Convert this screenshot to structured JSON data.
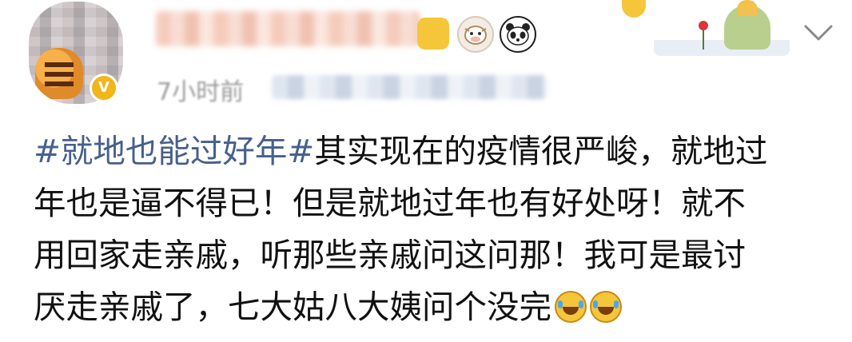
{
  "post": {
    "meta": {
      "time": "7小时前"
    },
    "hashtag": "#就地也能过好年#",
    "text_lines": [
      "其实现在的疫情很严峻，就地过",
      "年也是逼不得已！但是就地过年也有好处呀！就不",
      "用回家走亲戚，听那些亲戚问这问那！我可是最讨",
      "厌走亲戚了，七大姑八大姨问个没完"
    ],
    "trailing_emojis": [
      "laugh-cry-emoji",
      "laugh-cry-emoji"
    ]
  },
  "header": {
    "badges": [
      "gift-badge-icon",
      "cow-badge-icon",
      "panda-badge-icon"
    ],
    "verified_icon": "verified-v-icon",
    "menu_icon": "chevron-down-icon"
  },
  "colors": {
    "hashtag": "#46608d",
    "body_text": "#111111",
    "meta_text": "#9a9a9a",
    "verified_badge": "#f2b51c"
  }
}
